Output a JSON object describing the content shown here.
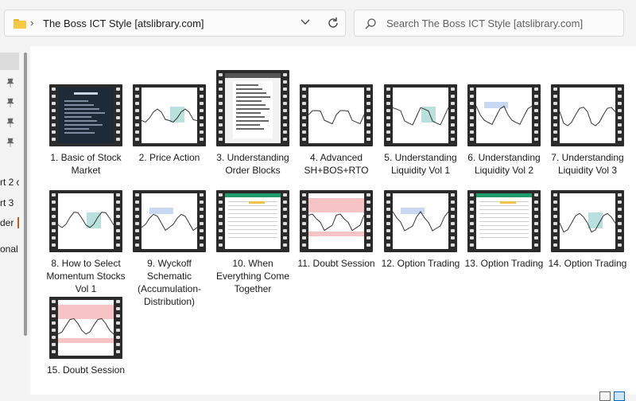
{
  "address": {
    "path": "The Boss ICT Style [atslibrary.com]"
  },
  "search": {
    "placeholder": "Search The Boss ICT Style [atslibrary.com]"
  },
  "nav": {
    "partial_labels": [
      "rt 2 c",
      "rt 3",
      "der",
      "onal"
    ]
  },
  "items": [
    {
      "label": "1. Basic of Stock Market",
      "style": "dark"
    },
    {
      "label": "2. Price Action",
      "style": "chart"
    },
    {
      "label": "3. Understanding Order Blocks",
      "style": "doc"
    },
    {
      "label": "4. Advanced SH+BOS+RTO",
      "style": "chart"
    },
    {
      "label": "5. Understanding Liquidity Vol 1",
      "style": "chart"
    },
    {
      "label": "6. Understanding Liquidity Vol 2",
      "style": "chart"
    },
    {
      "label": "7. Understanding Liquidity Vol 3",
      "style": "chart"
    },
    {
      "label": "8. How to Select Momentum Stocks Vol 1",
      "style": "chart"
    },
    {
      "label": "9. Wyckoff Schematic (Accumulation-Distribution)",
      "style": "chart"
    },
    {
      "label": "10. When Everything Come Together",
      "style": "table"
    },
    {
      "label": "11. Doubt Session",
      "style": "pink"
    },
    {
      "label": "12. Option Trading",
      "style": "chart"
    },
    {
      "label": "13. Option Trading",
      "style": "table"
    },
    {
      "label": "14. Option Trading",
      "style": "chart"
    },
    {
      "label": "15. Doubt Session",
      "style": "pink"
    }
  ]
}
